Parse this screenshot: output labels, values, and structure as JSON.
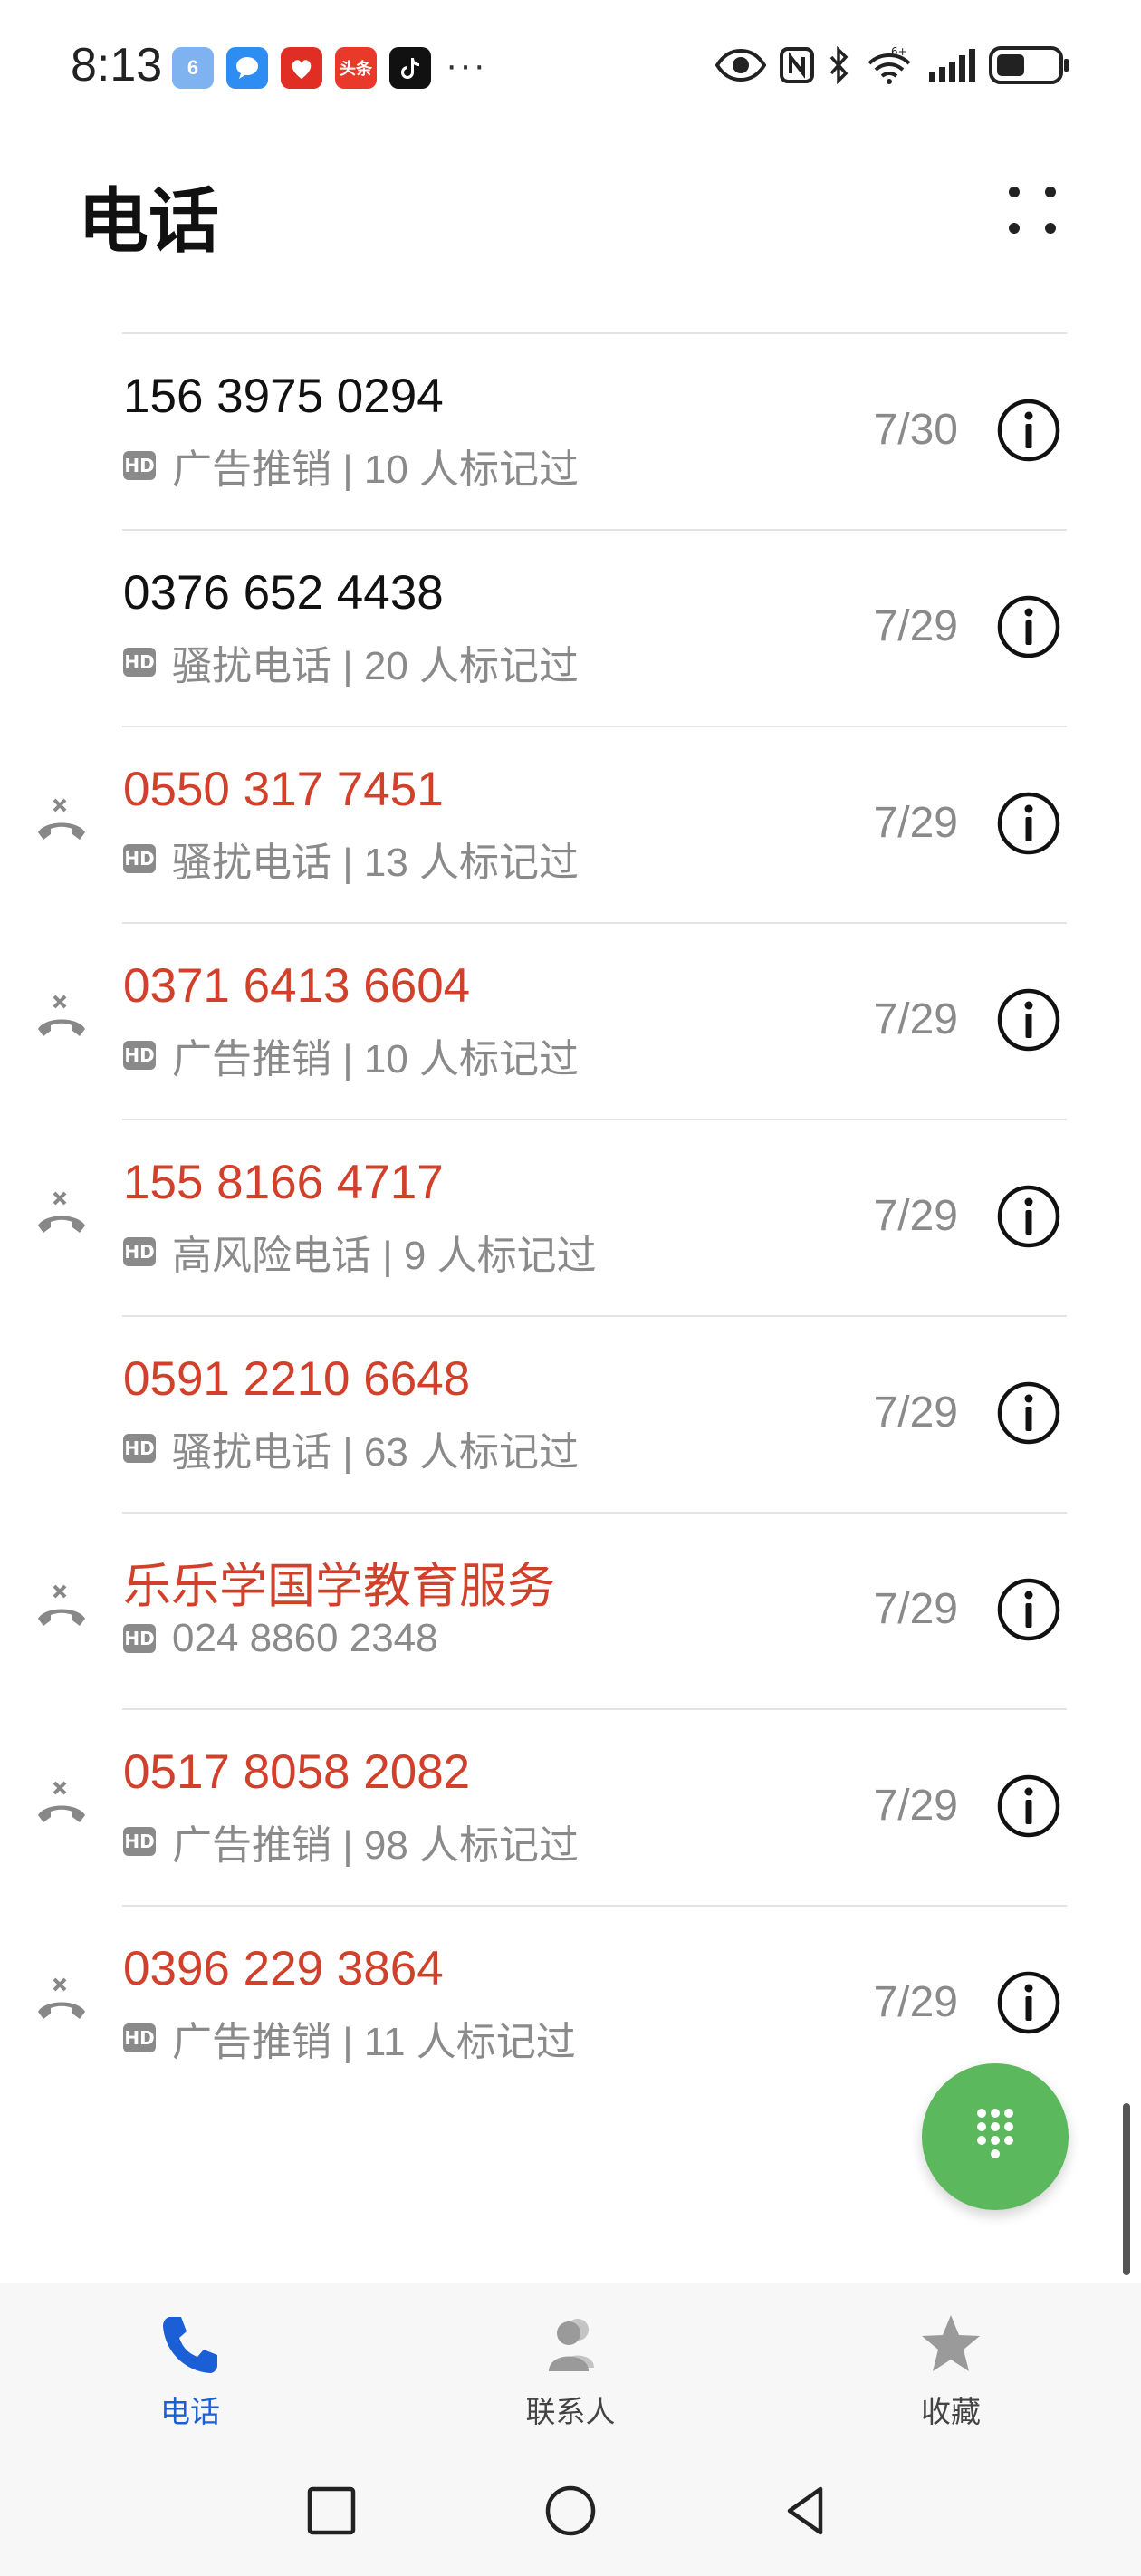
{
  "status_bar": {
    "time": "8:13",
    "apps": [
      "weather-app-icon",
      "message-app-icon",
      "pinduoduo-app-icon",
      "toutiao-app-icon",
      "tiktok-app-icon"
    ],
    "toutiao_label": "头条",
    "more": "···"
  },
  "header": {
    "title": "电话"
  },
  "calls": [
    {
      "name": "156 3975 0294",
      "tag": "广告推销 | 10 人标记过",
      "date": "7/30",
      "missed": false,
      "red": false
    },
    {
      "name": "0376 652 4438",
      "tag": "骚扰电话 | 20 人标记过",
      "date": "7/29",
      "missed": false,
      "red": false
    },
    {
      "name": "0550 317 7451",
      "tag": "骚扰电话 | 13 人标记过",
      "date": "7/29",
      "missed": true,
      "red": true
    },
    {
      "name": "0371 6413 6604",
      "tag": "广告推销 | 10 人标记过",
      "date": "7/29",
      "missed": true,
      "red": true
    },
    {
      "name": "155 8166 4717",
      "tag": "高风险电话 | 9 人标记过",
      "date": "7/29",
      "missed": true,
      "red": true
    },
    {
      "name": "0591 2210 6648",
      "tag": "骚扰电话 | 63 人标记过",
      "date": "7/29",
      "missed": false,
      "red": true
    },
    {
      "name": "乐乐学国学教育服务",
      "tag": "024 8860 2348",
      "date": "7/29",
      "missed": true,
      "red": true
    },
    {
      "name": "0517 8058 2082",
      "tag": "广告推销 | 98 人标记过",
      "date": "7/29",
      "missed": true,
      "red": true
    },
    {
      "name": "0396 229 3864",
      "tag": "广告推销 | 11 人标记过",
      "date": "7/29",
      "missed": true,
      "red": true
    }
  ],
  "hd_badge": "HD",
  "bottom_nav": {
    "tabs": [
      {
        "label": "电话",
        "icon": "phone-icon",
        "active": true
      },
      {
        "label": "联系人",
        "icon": "contacts-icon",
        "active": false
      },
      {
        "label": "收藏",
        "icon": "star-icon",
        "active": false
      }
    ]
  },
  "colors": {
    "missed_red": "#d0402a",
    "accent_blue": "#1a5fd6",
    "fab_green": "#5cb85c"
  }
}
